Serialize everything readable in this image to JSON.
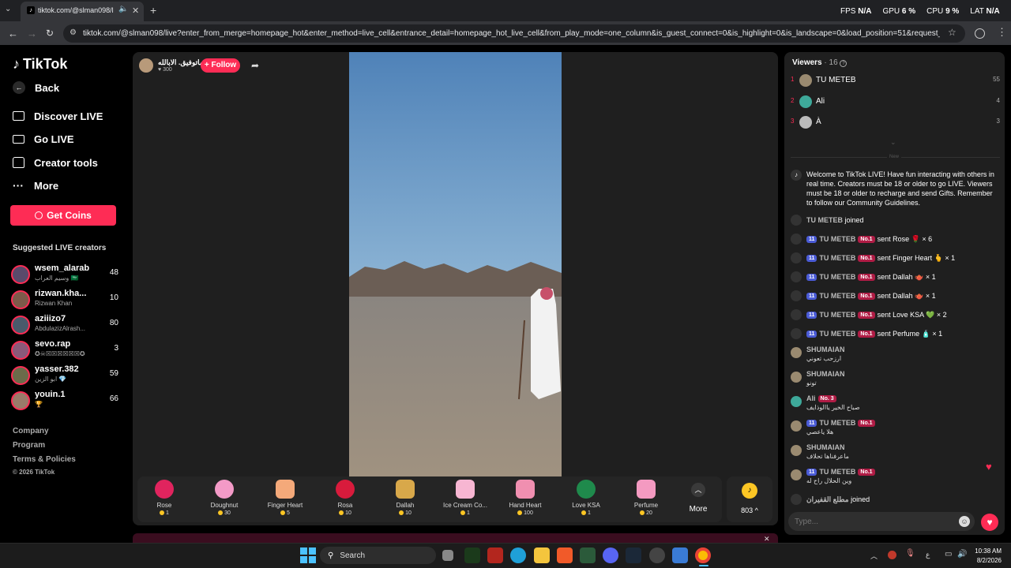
{
  "browser": {
    "tab_title": "tiktok.com/@slman098/live",
    "url": "tiktok.com/@slman098/live?enter_from_merge=homepage_hot&enter_method=live_cell&entrance_detail=homepage_hot_live_cell&from_play_mode=one_column&is_guest_connect=0&is_highlight=0&is_landscape=0&load_position=51&request_id=2026080215...",
    "stats": [
      {
        "label": "FPS",
        "value": "N/A"
      },
      {
        "label": "GPU",
        "value": "6 %"
      },
      {
        "label": "CPU",
        "value": "9 %"
      },
      {
        "label": "LAT",
        "value": "N/A"
      }
    ]
  },
  "sidebar": {
    "logo": "TikTok",
    "back": "Back",
    "nav": [
      {
        "label": "Discover LIVE",
        "icon": "live-icon"
      },
      {
        "label": "Go LIVE",
        "icon": "camera-icon"
      },
      {
        "label": "Creator tools",
        "icon": "creator-tools-icon"
      },
      {
        "label": "More",
        "icon": "more-dots-icon"
      }
    ],
    "get_coins": "Get Coins",
    "suggested_title": "Suggested LIVE creators",
    "creators": [
      {
        "name": "wsem_alarab",
        "sub": "وسيم العراب 🇸🇦",
        "count": "48"
      },
      {
        "name": "rizwan.kha...",
        "sub": "Rizwan Khan",
        "count": "10"
      },
      {
        "name": "aziiizo7",
        "sub": "AbdulazizAlrash...",
        "count": "80"
      },
      {
        "name": "sevo.rap",
        "sub": "✪☠☒☒☒☒☒☒✪",
        "count": "3"
      },
      {
        "name": "yasser.382",
        "sub": "ابو الزين 💎",
        "count": "59"
      },
      {
        "name": "youin.1",
        "sub": "🏆",
        "count": "66"
      }
    ],
    "footer": [
      "Company",
      "Program",
      "Terms & Policies",
      "© 2026 TikTok"
    ]
  },
  "stream": {
    "host_name": "ماتوفيق. الابالله",
    "host_likes": "300",
    "follow": "+ Follow"
  },
  "gifts": [
    {
      "name": "Rose",
      "price": "1",
      "color": "#e0245e"
    },
    {
      "name": "Doughnut",
      "price": "30",
      "color": "#f39ac7"
    },
    {
      "name": "Finger Heart",
      "price": "5",
      "color": "#f4a97a"
    },
    {
      "name": "Rosa",
      "price": "10",
      "color": "#d81b3c"
    },
    {
      "name": "Dallah",
      "price": "10",
      "color": "#d8a84a"
    },
    {
      "name": "Ice Cream Co...",
      "price": "1",
      "color": "#f7b6d2"
    },
    {
      "name": "Hand Heart",
      "price": "100",
      "color": "#f08fb0"
    },
    {
      "name": "Love KSA",
      "price": "1",
      "color": "#1f8a4c"
    },
    {
      "name": "Perfume",
      "price": "20",
      "color": "#f49ac1"
    }
  ],
  "gift_more": "More",
  "coin_balance": "803",
  "viewers": {
    "title": "Viewers",
    "count": "· 16",
    "list": [
      {
        "rank": "1",
        "name": "TU METEB",
        "score": "55"
      },
      {
        "rank": "2",
        "name": "Ali",
        "score": "4"
      },
      {
        "rank": "3",
        "name": "À",
        "score": "3"
      }
    ],
    "divider": "New"
  },
  "chat": {
    "welcome": "Welcome to TikTok LIVE! Have fun interacting with others in real time. Creators must be 18 or older to go LIVE. Viewers must be 18 or older to recharge and send Gifts. Remember to follow our Community Guidelines.",
    "joined_1_user": "TU METEB",
    "joined_label": "joined",
    "gift_user": "TU METEB",
    "level": "11",
    "rank_badge": "No.1",
    "gift_msgs": [
      {
        "text": "sent Rose",
        "emoji": "🌹",
        "qty": "× 6"
      },
      {
        "text": "sent Finger Heart",
        "emoji": "🫰",
        "qty": "× 1"
      },
      {
        "text": "sent Dallah",
        "emoji": "🫖",
        "qty": "× 1"
      },
      {
        "text": "sent Dallah",
        "emoji": "🫖",
        "qty": "× 1"
      },
      {
        "text": "sent Love KSA",
        "emoji": "💚",
        "qty": "× 2"
      },
      {
        "text": "sent Perfume",
        "emoji": "🧴",
        "qty": "× 1"
      }
    ],
    "c1_user": "SHUMAIAN",
    "c1_msg": "ارزحب تعوني",
    "c2_user": "SHUMAIAN",
    "c2_msg": "تونو",
    "c3_user": "Ali",
    "c3_badge": "No. 3",
    "c3_msg": "صباح الخير ياالوذايف",
    "c4_user": "TU METEB",
    "c4_msg": "هلا ياعصي",
    "c5_user": "SHUMAIAN",
    "c5_msg": "ماعرفناها تحلاف",
    "c6_user": "TU METEB",
    "c6_msg": "وين الحلال راح له",
    "joined_2_user": "مطلع القفيران",
    "input_placeholder": "Type..."
  },
  "taskbar": {
    "search": "Search",
    "time": "10:38 AM",
    "date": "8/2/2026"
  }
}
